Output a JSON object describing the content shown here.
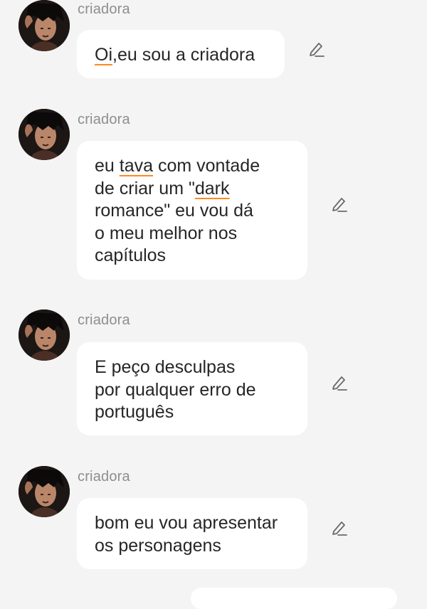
{
  "messages": [
    {
      "author": "criadora",
      "lines": [
        [
          {
            "t": "Oi",
            "spell": true
          },
          {
            "t": ",eu sou a criadora"
          }
        ]
      ]
    },
    {
      "author": "criadora",
      "lines": [
        [
          {
            "t": "eu "
          },
          {
            "t": "tava",
            "spell": true
          },
          {
            "t": " com vontade"
          }
        ],
        [
          {
            "t": "de criar um \""
          },
          {
            "t": "dark",
            "spell": true
          }
        ],
        [
          {
            "t": "romance\" eu vou dá"
          }
        ],
        [
          {
            "t": "o meu melhor nos"
          }
        ],
        [
          {
            "t": "capítulos"
          }
        ]
      ]
    },
    {
      "author": "criadora",
      "lines": [
        [
          {
            "t": "E peço desculpas"
          }
        ],
        [
          {
            "t": "por qualquer erro de"
          }
        ],
        [
          {
            "t": "português"
          }
        ]
      ]
    },
    {
      "author": "criadora",
      "lines": [
        [
          {
            "t": "bom eu vou apresentar"
          }
        ],
        [
          {
            "t": "os personagens"
          }
        ]
      ]
    }
  ],
  "icons": {
    "avatar": "avatar-icon",
    "edit": "pencil-icon"
  },
  "colors": {
    "background": "#f4f4f4",
    "bubble": "#ffffff",
    "author": "#8e8e8e",
    "text": "#262626",
    "spellcheck_underline": "#ff8a1f"
  }
}
